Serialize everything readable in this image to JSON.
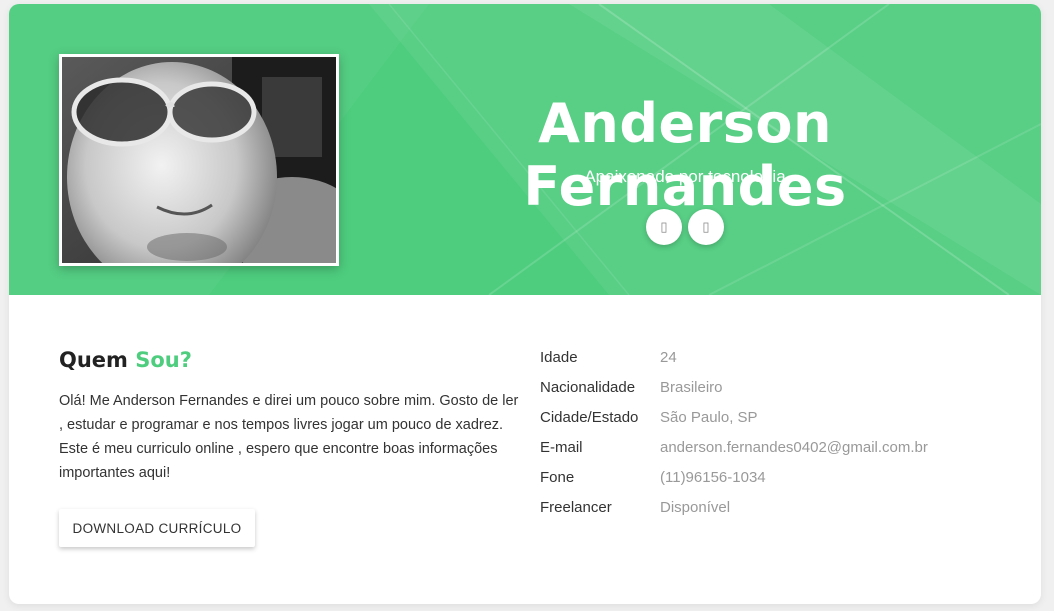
{
  "profile": {
    "name": "Anderson Fernandes",
    "tagline": "Apaixonado por tecnologia",
    "photo_description": "profile-photo",
    "social": [
      {
        "icon": "social-icon-1",
        "glyph": "▯"
      },
      {
        "icon": "social-icon-2",
        "glyph": "▯"
      }
    ]
  },
  "about": {
    "title_part1": "Quem ",
    "title_part2": "Sou?",
    "text": "Olá! Me Anderson Fernandes e direi um pouco sobre mim. Gosto de ler , estudar e programar e nos tempos livres jogar um pouco de xadrez. Este é meu curriculo online , espero que encontre boas informações importantes aqui!",
    "download_label": "DOWNLOAD CURRÍCULO"
  },
  "info": [
    {
      "label": "Idade",
      "value": "24"
    },
    {
      "label": "Nacionalidade",
      "value": "Brasileiro"
    },
    {
      "label": "Cidade/Estado",
      "value": "São Paulo, SP"
    },
    {
      "label": "E-mail",
      "value": "anderson.fernandes0402@gmail.com.br"
    },
    {
      "label": "Fone",
      "value": "(11)96156-1034"
    },
    {
      "label": "Freelancer",
      "value": "Disponível"
    }
  ],
  "colors": {
    "accent": "#4ecd7e",
    "header_bg": "#4ecd7e",
    "text_dark": "#222222",
    "text_muted": "#999999"
  }
}
